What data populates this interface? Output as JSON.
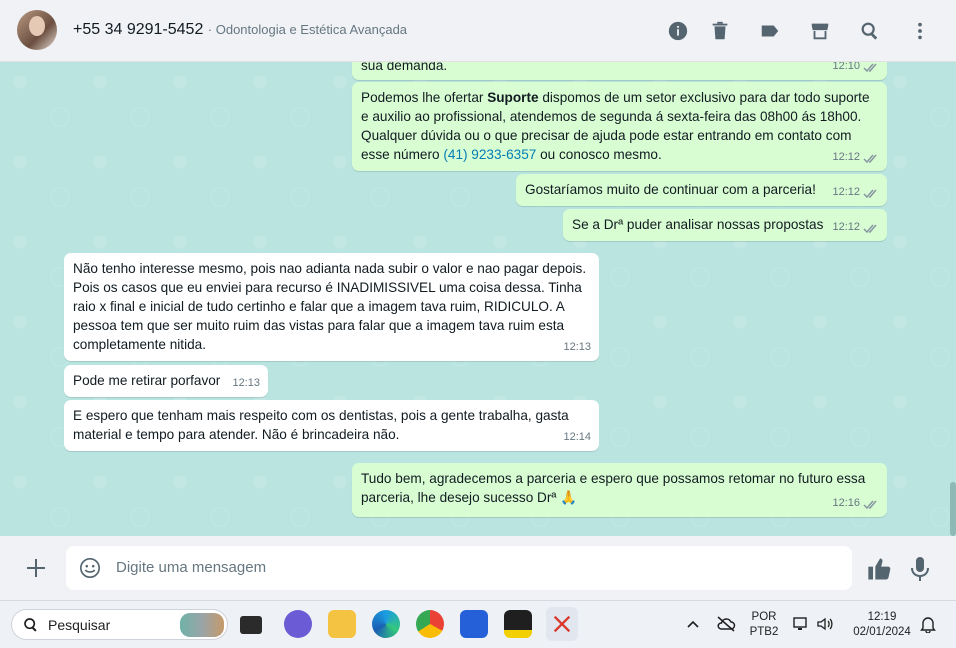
{
  "header": {
    "contact_phone": "+55 34 9291-5452",
    "contact_subtitle": "· Odontologia e Estética Avançada",
    "icons": [
      "info-icon",
      "trash-icon",
      "label-icon",
      "store-icon",
      "search-icon",
      "menu-icon"
    ]
  },
  "messages": [
    {
      "dir": "out",
      "text": "sua demanda.",
      "time": "12:10"
    },
    {
      "dir": "out",
      "text_parts": {
        "pre": "Podemos lhe ofertar ",
        "bold": "Suporte",
        "mid": " dispomos de um setor exclusivo para dar todo suporte e auxilio ao profissional, atendemos de segunda á sexta-feira das 08h00 ás 18h00. Qualquer dúvida ou o que precisar de ajuda pode estar entrando em contato com esse número ",
        "link": "(41) 9233-6357",
        "post": " ou conosco mesmo."
      },
      "time": "12:12"
    },
    {
      "dir": "out",
      "text": "Gostaríamos muito de continuar com a parceria!",
      "time": "12:12"
    },
    {
      "dir": "out",
      "text": "Se a Drª puder analisar nossas propostas",
      "time": "12:12"
    },
    {
      "dir": "in",
      "text": "Não tenho interesse mesmo, pois nao adianta nada subir o valor e nao pagar depois. Pois os casos que eu enviei para recurso é INADIMISSIVEL uma coisa dessa. Tinha raio x final e inicial de tudo certinho e falar que a imagem tava ruim, RIDICULO. A pessoa tem que ser muito ruim das vistas para falar que a imagem tava ruim esta completamente nitida.",
      "time": "12:13"
    },
    {
      "dir": "in",
      "text": "Pode me retirar porfavor",
      "time": "12:13"
    },
    {
      "dir": "in",
      "text": "E espero que tenham mais respeito com os dentistas, pois a gente trabalha, gasta material e tempo para atender. Não é brincadeira não.",
      "time": "12:14"
    },
    {
      "dir": "out",
      "text": "Tudo bem, agradecemos a parceria e espero que possamos retomar no futuro essa parceria, lhe desejo sucesso Drª 🙏",
      "time": "12:16"
    }
  ],
  "composer": {
    "placeholder": "Digite uma mensagem"
  },
  "taskbar": {
    "search_label": "Pesquisar",
    "lang_line1": "POR",
    "lang_line2": "PTB2",
    "time": "12:19",
    "date": "02/01/2024"
  },
  "colors": {
    "chat_bg": "#b9e4df",
    "outgoing_bubble": "#d9fdd3",
    "incoming_bubble": "#ffffff",
    "link": "#027eb5"
  }
}
